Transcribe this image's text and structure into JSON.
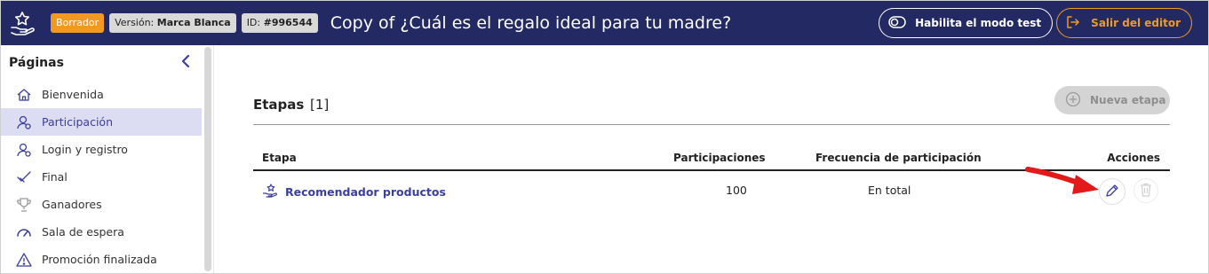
{
  "topbar": {
    "badge_draft": "Borrador",
    "version_label": "Versión:",
    "version_value": "Marca Blanca",
    "id_label": "ID:",
    "id_value": "#996544",
    "title": "Copy of ¿Cuál es el regalo ideal para tu madre?",
    "test_mode_label": "Habilita el modo test",
    "exit_label": "Salir del editor",
    "colors": {
      "background": "#232a63",
      "accent": "#f29a1f"
    }
  },
  "sidebar": {
    "title": "Páginas",
    "items": [
      {
        "label": "Bienvenida",
        "icon": "home-icon"
      },
      {
        "label": "Participación",
        "icon": "user-participation-icon",
        "active": true
      },
      {
        "label": "Login y registro",
        "icon": "user-login-icon"
      },
      {
        "label": "Final",
        "icon": "check-icon"
      },
      {
        "label": "Ganadores",
        "icon": "trophy-icon"
      },
      {
        "label": "Sala de espera",
        "icon": "gauge-icon"
      },
      {
        "label": "Promoción finalizada",
        "icon": "warning-icon"
      }
    ]
  },
  "main": {
    "section_title": "Etapas",
    "section_count": "[1]",
    "new_stage_label": "Nueva etapa",
    "table": {
      "headers": {
        "stage": "Etapa",
        "participations": "Participaciones",
        "frequency": "Frecuencia de participación",
        "actions": "Acciones"
      },
      "rows": [
        {
          "stage": "Recomendador productos",
          "participations": "100",
          "frequency": "En total"
        }
      ]
    }
  }
}
